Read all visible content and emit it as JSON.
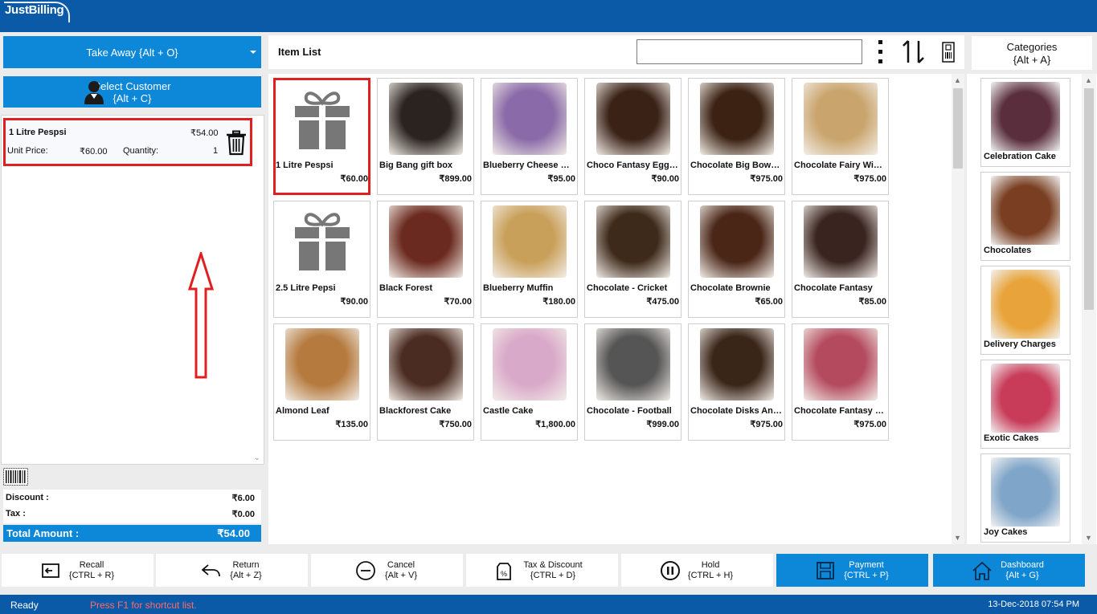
{
  "app": {
    "logo": "JustBilling"
  },
  "order": {
    "type_label": "Take Away {Alt + O}"
  },
  "customer": {
    "label_line1": "Select Customer",
    "label_line2": "{Alt + C}"
  },
  "cart": {
    "lines": [
      {
        "name": "1 Litre Pespsi",
        "total": "₹54.00",
        "unit_price_label": "Unit Price:",
        "unit_price": "₹60.00",
        "quantity_label": "Quantity:",
        "quantity": "1"
      }
    ]
  },
  "summary": {
    "discount_label": "Discount :",
    "discount": "₹6.00",
    "tax_label": "Tax :",
    "tax": "₹0.00",
    "total_label": "Total Amount :",
    "total": "₹54.00"
  },
  "item_list": {
    "title": "Item List",
    "items": [
      {
        "name": "1 Litre Pespsi",
        "price": "₹60.00",
        "icon": "gift-icon",
        "color": "#777777"
      },
      {
        "name": "Big Bang gift box",
        "price": "₹899.00",
        "color": "#2a2320"
      },
      {
        "name": "Blueberry Cheese Ca...",
        "price": "₹95.00",
        "color": "#8a6aa8"
      },
      {
        "name": "Choco Fantasy Eggle...",
        "price": "₹90.00",
        "color": "#3a2217"
      },
      {
        "name": "Chocolate Big Bow C...",
        "price": "₹975.00",
        "color": "#3b2213"
      },
      {
        "name": "Chocolate Fairy Win...",
        "price": "₹975.00",
        "color": "#c9a46c"
      },
      {
        "name": "2.5 Litre Pepsi",
        "price": "₹90.00",
        "icon": "gift-icon",
        "color": "#777777"
      },
      {
        "name": "Black Forest",
        "price": "₹70.00",
        "color": "#6b2a1f"
      },
      {
        "name": "Blueberry Muffin",
        "price": "₹180.00",
        "color": "#c9a05a"
      },
      {
        "name": "Chocolate - Cricket",
        "price": "₹475.00",
        "color": "#3e2a1a"
      },
      {
        "name": "Chocolate Brownie",
        "price": "₹65.00",
        "color": "#4a2617"
      },
      {
        "name": "Chocolate Fantasy",
        "price": "₹85.00",
        "color": "#3a2420"
      },
      {
        "name": "Almond Leaf",
        "price": "₹135.00",
        "color": "#b57a3e"
      },
      {
        "name": "Blackforest Cake",
        "price": "₹750.00",
        "color": "#4b2c22"
      },
      {
        "name": "Castle Cake",
        "price": "₹1,800.00",
        "color": "#d9a9c9"
      },
      {
        "name": "Chocolate - Football",
        "price": "₹999.00",
        "color": "#555555"
      },
      {
        "name": "Chocolate Disks And...",
        "price": "₹975.00",
        "color": "#3a2519"
      },
      {
        "name": "Chocolate Fantasy C...",
        "price": "₹975.00",
        "color": "#b44a5e"
      }
    ]
  },
  "categories": {
    "title_line1": "Categories",
    "title_line2": "{Alt + A}",
    "items": [
      {
        "name": "Celebration Cake",
        "color": "#5a2e3c"
      },
      {
        "name": "Chocolates",
        "color": "#7a3f22"
      },
      {
        "name": "Delivery Charges",
        "color": "#e8a43a"
      },
      {
        "name": "Exotic Cakes",
        "color": "#c83c5a"
      },
      {
        "name": "Joy Cakes",
        "color": "#7fa5c8"
      }
    ]
  },
  "toolbar": {
    "recall": {
      "label": "Recall",
      "shortcut": "{CTRL + R}"
    },
    "return": {
      "label": "Return",
      "shortcut": "{Alt + Z}"
    },
    "cancel": {
      "label": "Cancel",
      "shortcut": "{Alt + V}"
    },
    "tax_discount": {
      "label": "Tax & Discount",
      "shortcut": "{CTRL + D}"
    },
    "hold": {
      "label": "Hold",
      "shortcut": "{CTRL + H}"
    },
    "payment": {
      "label": "Payment",
      "shortcut": "{CTRL + P}"
    },
    "dashboard": {
      "label": "Dashboard",
      "shortcut": "{Alt + G}"
    }
  },
  "status": {
    "ready": "Ready",
    "hint": "Press F1 for shortcut list.",
    "datetime": "13-Dec-2018 07:54 PM"
  },
  "colors": {
    "brand": "#0a5aa8",
    "accent": "#0d87d8",
    "highlight": "#e02020"
  }
}
